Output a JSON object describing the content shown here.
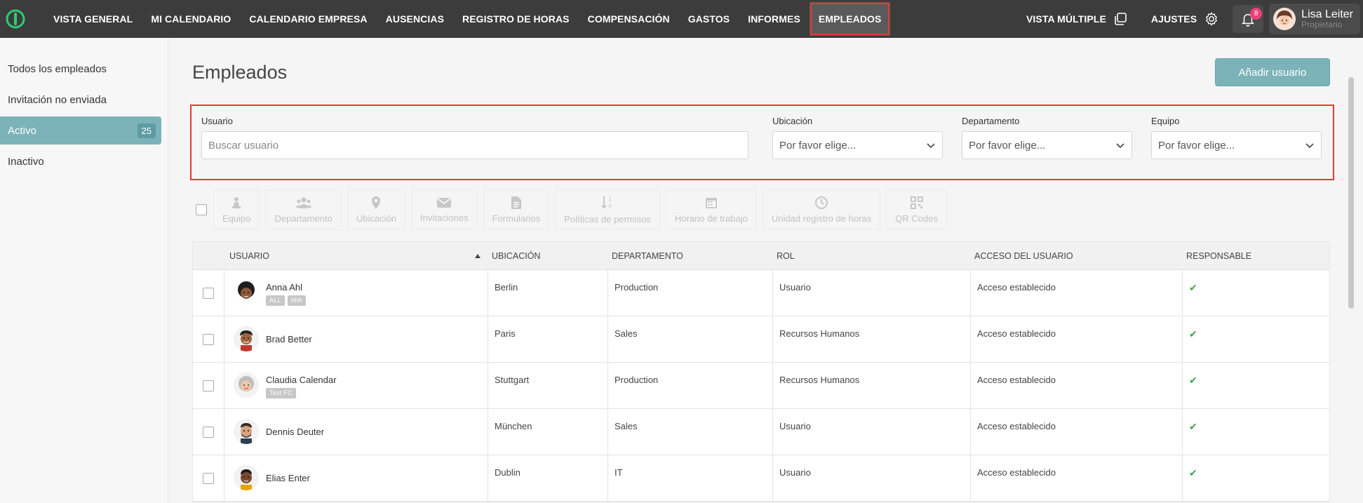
{
  "nav": {
    "logo_icon": "app-logo",
    "items": [
      {
        "label": "VISTA GENERAL"
      },
      {
        "label": "MI CALENDARIO"
      },
      {
        "label": "CALENDARIO EMPRESA"
      },
      {
        "label": "AUSENCIAS"
      },
      {
        "label": "REGISTRO DE HORAS"
      },
      {
        "label": "COMPENSACIÓN"
      },
      {
        "label": "GASTOS"
      },
      {
        "label": "INFORMES"
      },
      {
        "label": "EMPLEADOS"
      }
    ],
    "active_item": "EMPLEADOS",
    "vista_multiple": "VISTA MÚLTIPLE",
    "ajustes": "AJUSTES",
    "notifications_count": "8",
    "user_name": "Lisa Leiter",
    "user_role": "Propietario"
  },
  "sidebar": {
    "items": [
      {
        "label": "Todos los empleados"
      },
      {
        "label": "Invitación no enviada"
      },
      {
        "label": "Activo",
        "count": "25"
      },
      {
        "label": "Inactivo"
      }
    ]
  },
  "main": {
    "title": "Empleados",
    "add_button": "Añadir usuario",
    "filters": {
      "usuario_label": "Usuario",
      "usuario_placeholder": "Buscar usuario",
      "ubicacion_label": "Ubicación",
      "ubicacion_value": "Por favor elige...",
      "departamento_label": "Departamento",
      "departamento_value": "Por favor elige...",
      "equipo_label": "Equipo",
      "equipo_value": "Por favor elige..."
    },
    "toolbar": [
      {
        "label": "Equipo",
        "icon": "chess-piece-icon"
      },
      {
        "label": "Departamento",
        "icon": "group-icon"
      },
      {
        "label": "Ubicación",
        "icon": "map-pin-icon"
      },
      {
        "label": "Invitaciones",
        "icon": "envelope-icon"
      },
      {
        "label": "Formularios",
        "icon": "document-icon"
      },
      {
        "label": "Políticas de permisos",
        "icon": "sort-numeric-icon"
      },
      {
        "label": "Horario de trabajo",
        "icon": "calendar-icon"
      },
      {
        "label": "Unidad registro de horas",
        "icon": "clock-icon"
      },
      {
        "label": "QR Codes",
        "icon": "qr-code-icon"
      }
    ],
    "table": {
      "headers": [
        "USUARIO",
        "UBICACIÓN",
        "DEPARTAMENTO",
        "ROL",
        "ACCESO DEL USUARIO",
        "RESPONSABLE"
      ],
      "rows": [
        {
          "name": "Anna Ahl",
          "tags": [
            "ALL",
            "hhh"
          ],
          "location": "Berlin",
          "department": "Production",
          "role": "Usuario",
          "access": "Acceso establecido",
          "responsible": "✔"
        },
        {
          "name": "Brad Better",
          "tags": [],
          "location": "Paris",
          "department": "Sales",
          "role": "Recursos Humanos",
          "access": "Acceso establecido",
          "responsible": "✔"
        },
        {
          "name": "Claudia Calendar",
          "tags": [
            "Test FC"
          ],
          "location": "Stuttgart",
          "department": "Production",
          "role": "Recursos Humanos",
          "access": "Acceso establecido",
          "responsible": "✔"
        },
        {
          "name": "Dennis Deuter",
          "tags": [],
          "location": "München",
          "department": "Sales",
          "role": "Usuario",
          "access": "Acceso establecido",
          "responsible": "✔"
        },
        {
          "name": "Elias Enter",
          "tags": [],
          "location": "Dublin",
          "department": "IT",
          "role": "Usuario",
          "access": "Acceso establecido",
          "responsible": "✔"
        }
      ]
    }
  },
  "colors": {
    "nav_bg": "#3c3c3c",
    "accent": "#7bb3b9",
    "highlight": "#e53935",
    "badge": "#ec407a",
    "check": "#43a047"
  }
}
